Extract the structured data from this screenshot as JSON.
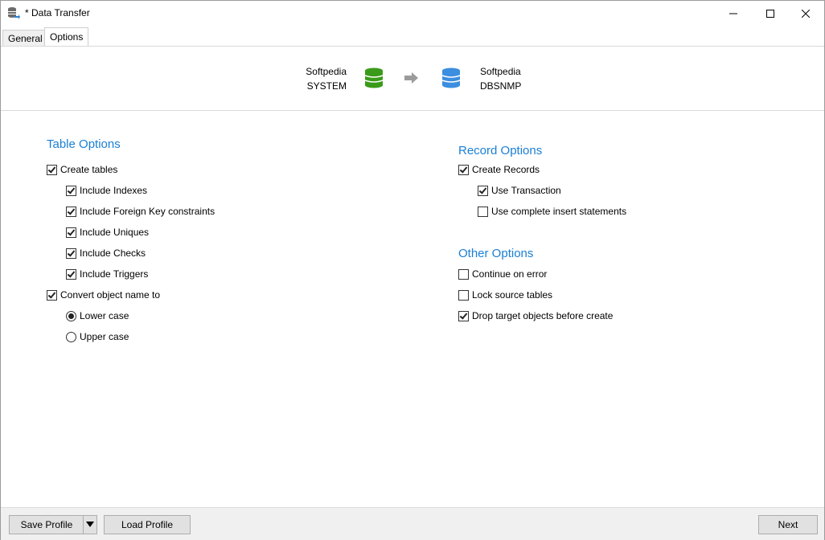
{
  "window": {
    "title": "* Data Transfer"
  },
  "tabs": [
    {
      "label": "General"
    },
    {
      "label": "Options"
    }
  ],
  "transfer": {
    "source": {
      "line1": "Softpedia",
      "line2": "SYSTEM"
    },
    "target": {
      "line1": "Softpedia",
      "line2": "DBSNMP"
    }
  },
  "table_options": {
    "title": "Table Options",
    "create_tables": {
      "label": "Create tables",
      "checked": true
    },
    "include_indexes": {
      "label": "Include Indexes",
      "checked": true
    },
    "include_fk": {
      "label": "Include Foreign Key constraints",
      "checked": true
    },
    "include_uniques": {
      "label": "Include Uniques",
      "checked": true
    },
    "include_checks": {
      "label": "Include Checks",
      "checked": true
    },
    "include_triggers": {
      "label": "Include Triggers",
      "checked": true
    },
    "convert_name": {
      "label": "Convert object name to",
      "checked": true
    },
    "lower_case": {
      "label": "Lower case",
      "selected": true
    },
    "upper_case": {
      "label": "Upper case",
      "selected": false
    }
  },
  "record_options": {
    "title": "Record Options",
    "create_records": {
      "label": "Create Records",
      "checked": true
    },
    "use_transaction": {
      "label": "Use Transaction",
      "checked": true
    },
    "complete_insert": {
      "label": "Use complete insert statements",
      "checked": false
    }
  },
  "other_options": {
    "title": "Other Options",
    "continue_on_error": {
      "label": "Continue on error",
      "checked": false
    },
    "lock_source": {
      "label": "Lock source tables",
      "checked": false
    },
    "drop_target": {
      "label": "Drop target objects before create",
      "checked": true
    }
  },
  "footer": {
    "save_profile": "Save Profile",
    "load_profile": "Load Profile",
    "next": "Next"
  },
  "colors": {
    "section_title": "#1a7fd4",
    "db_source": "#3a9b1a",
    "db_target": "#3b8ee0"
  }
}
